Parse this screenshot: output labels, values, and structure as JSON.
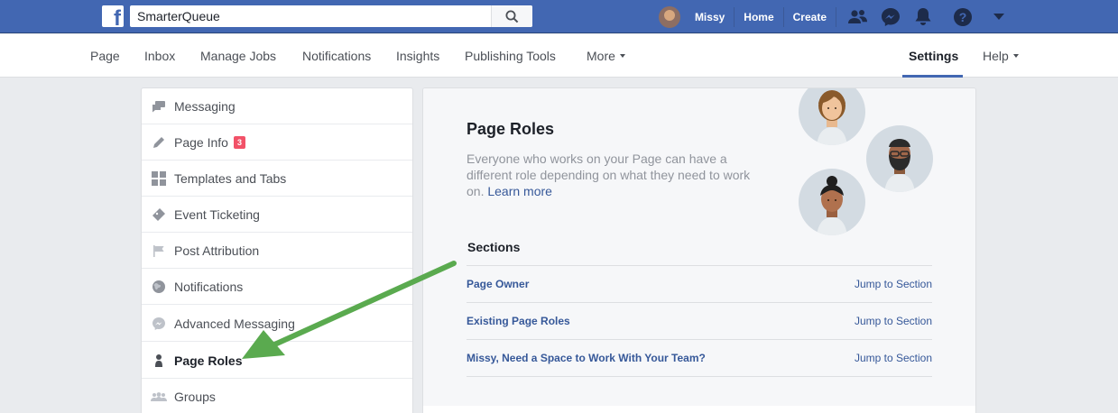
{
  "topbar": {
    "search_value": "SmarterQueue",
    "user_name": "Missy",
    "home": "Home",
    "create": "Create"
  },
  "subnav": {
    "items": [
      "Page",
      "Inbox",
      "Manage Jobs",
      "Notifications",
      "Insights",
      "Publishing Tools",
      "More"
    ],
    "settings": "Settings",
    "help": "Help"
  },
  "leftmenu": {
    "items": [
      {
        "label": "Messaging",
        "icon": "chat-icon"
      },
      {
        "label": "Page Info",
        "icon": "pencil-icon",
        "badge": "3"
      },
      {
        "label": "Templates and Tabs",
        "icon": "grid-icon"
      },
      {
        "label": "Event Ticketing",
        "icon": "ticket-icon"
      },
      {
        "label": "Post Attribution",
        "icon": "flag-icon"
      },
      {
        "label": "Notifications",
        "icon": "globe-icon"
      },
      {
        "label": "Advanced Messaging",
        "icon": "messenger-icon"
      },
      {
        "label": "Page Roles",
        "icon": "person-icon"
      },
      {
        "label": "Groups",
        "icon": "group-icon"
      }
    ]
  },
  "main": {
    "title": "Page Roles",
    "description": "Everyone who works on your Page can have a different role depending on what they need to work on.",
    "learn_more": "Learn more",
    "sections_heading": "Sections",
    "sections": [
      {
        "label": "Page Owner",
        "action": "Jump to Section"
      },
      {
        "label": "Existing Page Roles",
        "action": "Jump to Section"
      },
      {
        "label": "Missy, Need a Space to Work With Your Team?",
        "action": "Jump to Section"
      }
    ]
  },
  "colors": {
    "brand": "#4267b2",
    "link": "#365899",
    "badge": "#f25268",
    "arrow": "#5aaa4f"
  }
}
